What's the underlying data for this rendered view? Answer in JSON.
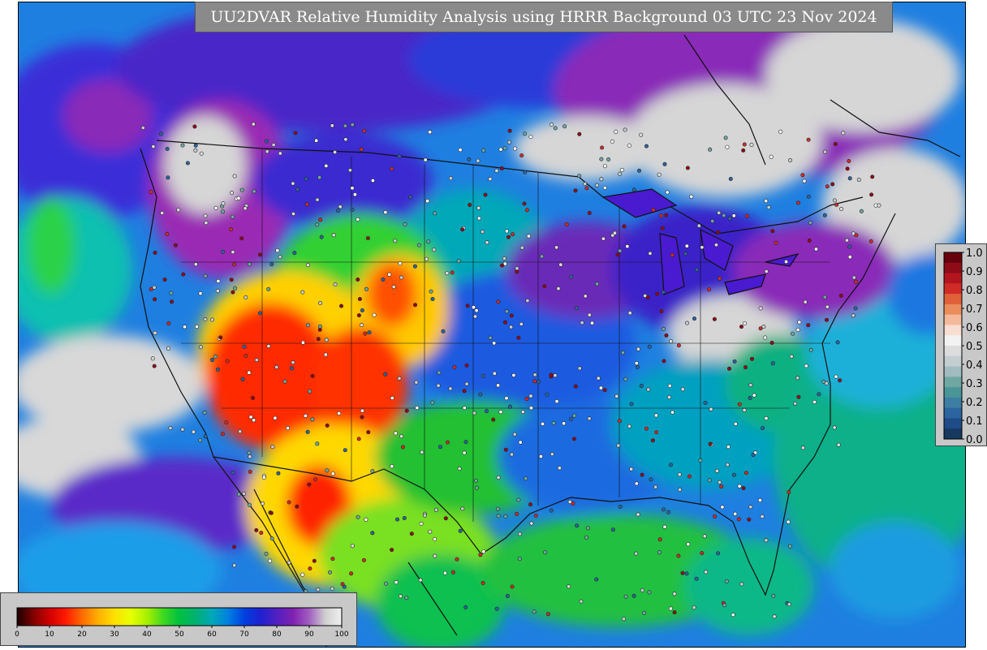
{
  "title": "UU2DVAR Relative Humidity Analysis using HRRR Background 03 UTC 23 Nov 2024",
  "colors": {
    "ocean_low": "#1aa0e6",
    "moist": "#3b2bd6",
    "very_moist": "#7a1fb0",
    "saturated": "#d0d0d0",
    "dry": "#ff1a00",
    "semi_dry": "#ffd200",
    "mid": "#22cc22",
    "frame": "#000000",
    "panel": "#c8c8c8",
    "banner": "#8a8a8a"
  },
  "legend_obs": {
    "ticks": [
      "1.0",
      "0.9",
      "0.8",
      "0.7",
      "0.6",
      "0.5",
      "0.4",
      "0.3",
      "0.2",
      "0.1",
      "0.0"
    ],
    "swatches": [
      "#67000d",
      "#8e0b17",
      "#b3151f",
      "#d02b26",
      "#e0603a",
      "#eb8c5d",
      "#f4b99b",
      "#f8ddd2",
      "#f2f2f2",
      "#dcdcdc",
      "#c4cdd0",
      "#a0bcc0",
      "#6fa7a3",
      "#4b9598",
      "#3f7ea3",
      "#2c64a0",
      "#1f4b86",
      "#17395f"
    ]
  },
  "legend_rh": {
    "ticks": [
      "0",
      "10",
      "20",
      "30",
      "40",
      "50",
      "60",
      "70",
      "80",
      "90",
      "100"
    ],
    "gradient": [
      "#1a0000",
      "#800000",
      "#d00000",
      "#ff1a00",
      "#ff6a00",
      "#ffb000",
      "#ffe000",
      "#e8ff00",
      "#a8f000",
      "#40d820",
      "#00c040",
      "#00b070",
      "#00a8b8",
      "#0080e0",
      "#0040e0",
      "#2020d0",
      "#5020c0",
      "#8020b0",
      "#a060c0",
      "#d0d0d0",
      "#f0f0f0"
    ]
  }
}
